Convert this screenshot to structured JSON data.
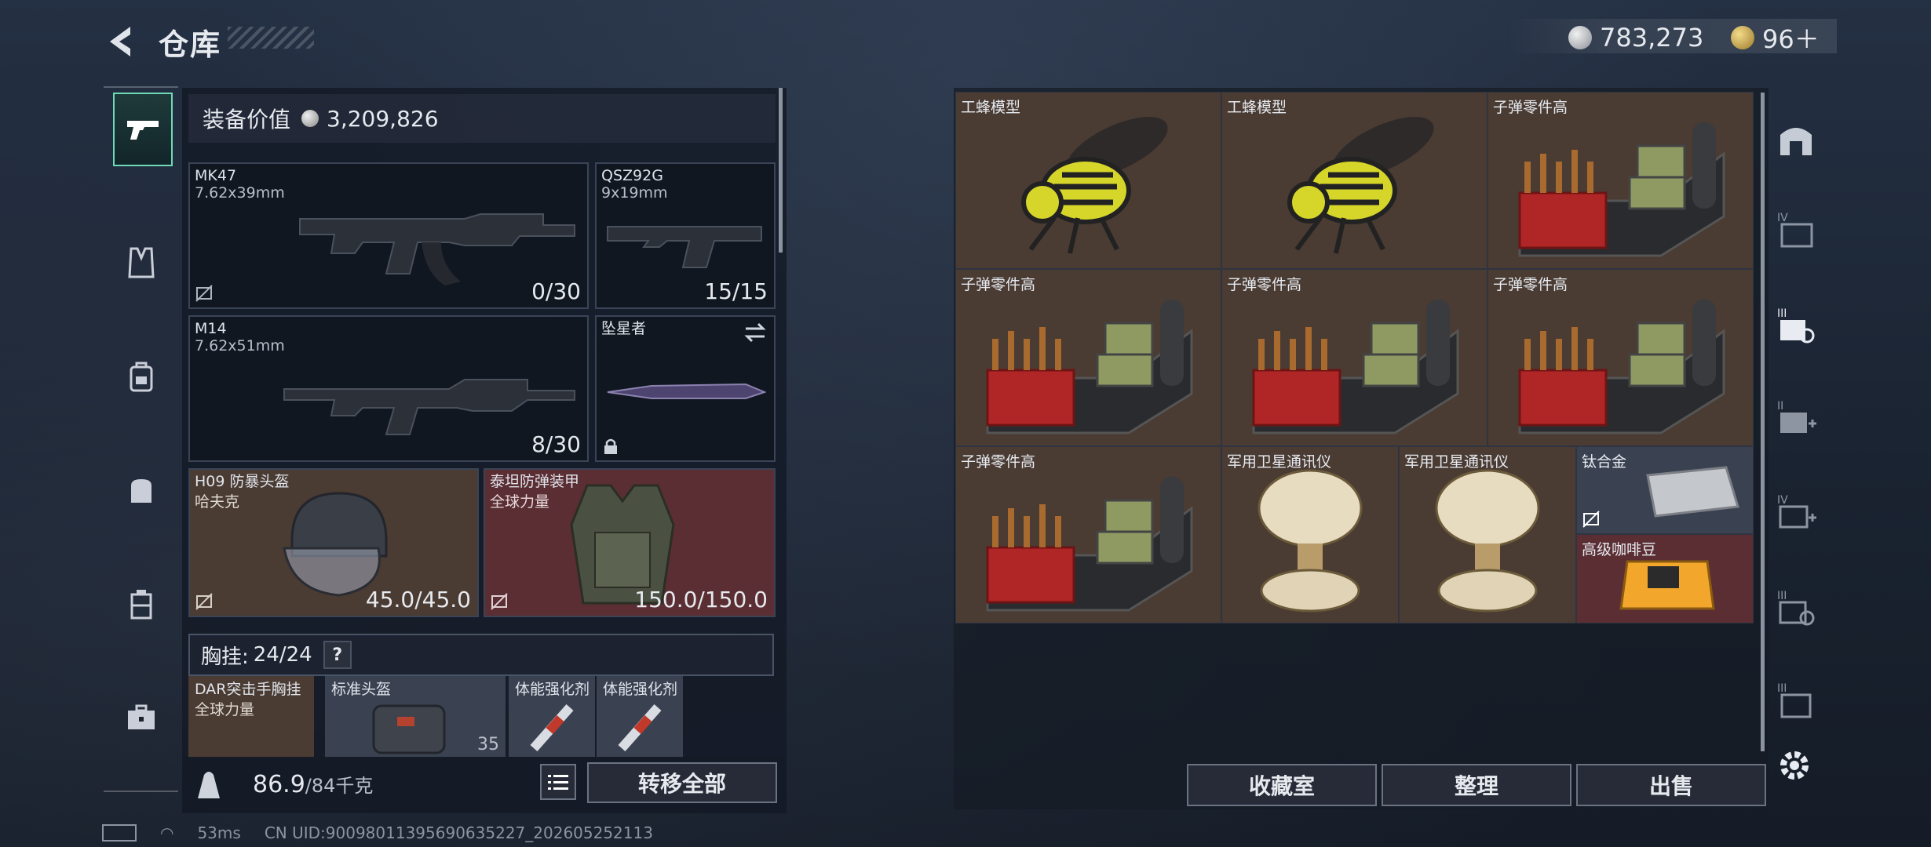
{
  "header": {
    "title": "仓库"
  },
  "currency": {
    "silver": "783,273",
    "gold": "96＋"
  },
  "loadout": {
    "value_label": "装备价值",
    "value": "3,209,826",
    "slots": {
      "primary": {
        "name": "MK47",
        "ammo": "7.62x39mm",
        "count": "0/30"
      },
      "pistol": {
        "name": "QSZ92G",
        "ammo": "9x19mm",
        "count": "15/15"
      },
      "secondary": {
        "name": "M14",
        "ammo": "7.62x51mm",
        "count": "8/30"
      },
      "melee": {
        "name": "坠星者"
      },
      "helmet": {
        "name": "H09 防暴头盔",
        "brand": "哈夫克",
        "durability": "45.0/45.0"
      },
      "armor": {
        "name": "泰坦防弹装甲",
        "brand": "全球力量",
        "durability": "150.0/150.0"
      }
    },
    "chest_rig": {
      "label": "胸挂:",
      "value": "24/24",
      "help": "?"
    },
    "rig_items": [
      {
        "name": "DAR突击手胸挂",
        "sub": "全球力量"
      },
      {
        "name": "标准头盔",
        "sub": "",
        "count": "35"
      },
      {
        "name": "体能强化剂"
      },
      {
        "name": "体能强化剂"
      }
    ],
    "weight": "86.9",
    "weight_max": "/84千克",
    "transfer_all": "转移全部"
  },
  "storage": {
    "items": [
      {
        "name": "工蜂模型"
      },
      {
        "name": "工蜂模型"
      },
      {
        "name": "子弹零件高"
      },
      {
        "name": "子弹零件高"
      },
      {
        "name": "子弹零件高"
      },
      {
        "name": "子弹零件高"
      },
      {
        "name": "子弹零件高"
      },
      {
        "name": "军用卫星通讯仪"
      },
      {
        "name": "军用卫星通讯仪"
      },
      {
        "name": "钛合金"
      },
      {
        "name": "高级咖啡豆"
      }
    ],
    "buttons": {
      "collection": "收藏室",
      "sort": "整理",
      "sell": "出售"
    }
  },
  "status": {
    "ping": "53ms",
    "uid": "CN UID:900980113956906352​27_202605252113"
  },
  "colors": {
    "accent": "#6fd9b7",
    "brown_cell": "#4a3b33",
    "red_cell": "#5a2e33"
  }
}
